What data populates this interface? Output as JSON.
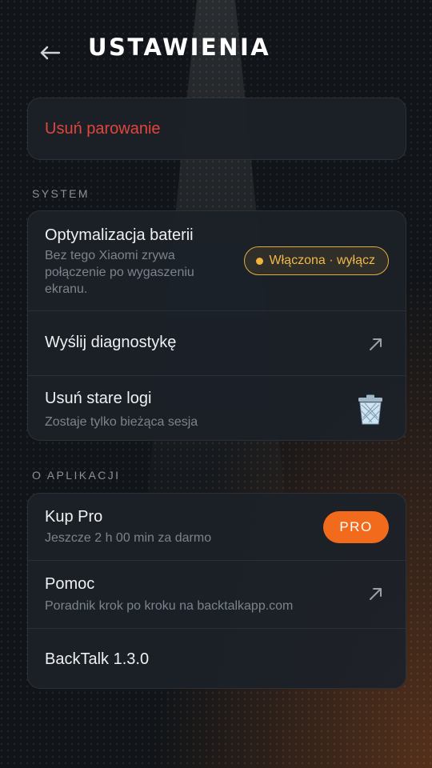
{
  "header": {
    "title": "USTAWIENIA",
    "back_icon": "arrow-left-icon"
  },
  "pairing": {
    "unpair_label": "Usuń parowanie"
  },
  "system": {
    "section_label": "SYSTEM",
    "battery": {
      "title": "Optymalizacja baterii",
      "subtitle_lines": [
        "Bez tego Xiaomi zrywa",
        "połączenie po wygaszeniu",
        "ekranu."
      ],
      "status_label": "Włączona · wyłącz",
      "status_color": "#e4ac3f"
    },
    "diagnostics": {
      "title": "Wyślij diagnostykę",
      "icon": "external-link-icon"
    },
    "logs": {
      "title": "Usuń stare logi",
      "subtitle": "Zostaje tylko bieżąca sesja",
      "icon": "trash-icon"
    }
  },
  "about": {
    "section_label": "O APLIKACJI",
    "pro": {
      "title": "Kup Pro",
      "subtitle": "Jeszcze 2 h 00 min za darmo",
      "badge": "PRO",
      "badge_color": "#f26b1d"
    },
    "help": {
      "title": "Pomoc",
      "subtitle": "Poradnik krok po kroku na backtalkapp.com",
      "icon": "external-link-icon"
    },
    "version": {
      "label": "BackTalk 1.3.0"
    }
  },
  "colors": {
    "danger": "#e2453b",
    "background": "#111418",
    "card": "#1c2128"
  }
}
